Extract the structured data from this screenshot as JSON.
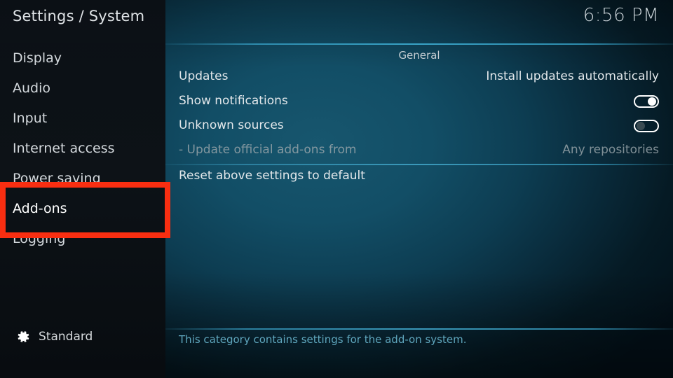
{
  "header": {
    "title": "Settings / System",
    "clock": "6:56 PM"
  },
  "sidebar": {
    "items": [
      {
        "label": "Display",
        "selected": false
      },
      {
        "label": "Audio",
        "selected": false
      },
      {
        "label": "Input",
        "selected": false
      },
      {
        "label": "Internet access",
        "selected": false
      },
      {
        "label": "Power saving",
        "selected": false
      },
      {
        "label": "Add-ons",
        "selected": true
      },
      {
        "label": "Logging",
        "selected": false
      }
    ],
    "profile": {
      "icon": "gear-icon",
      "label": "Standard"
    }
  },
  "main": {
    "group_header": "General",
    "rows": [
      {
        "label": "Updates",
        "value": "Install updates automatically",
        "type": "value",
        "dim": false
      },
      {
        "label": "Show notifications",
        "value": "on",
        "type": "toggle",
        "dim": false
      },
      {
        "label": "Unknown sources",
        "value": "off",
        "type": "toggle",
        "dim": false
      },
      {
        "label": "- Update official add-ons from",
        "value": "Any repositories",
        "type": "value",
        "dim": true
      },
      {
        "label": "Reset above settings to default",
        "value": "",
        "type": "action",
        "dim": false
      }
    ],
    "footer_description": "This category contains settings for the add-on system."
  },
  "annotation": {
    "shape": "rectangle-highlight",
    "color": "#f92e11",
    "target": "Add-ons"
  },
  "colors": {
    "accent_highlight": "#1288ac",
    "panel_teal": "#124e66",
    "sidebar_dark": "#0d1217",
    "rule_teal": "#2b7f9e",
    "footer_text": "#5fa6bd",
    "annotation_red": "#f92e11"
  }
}
